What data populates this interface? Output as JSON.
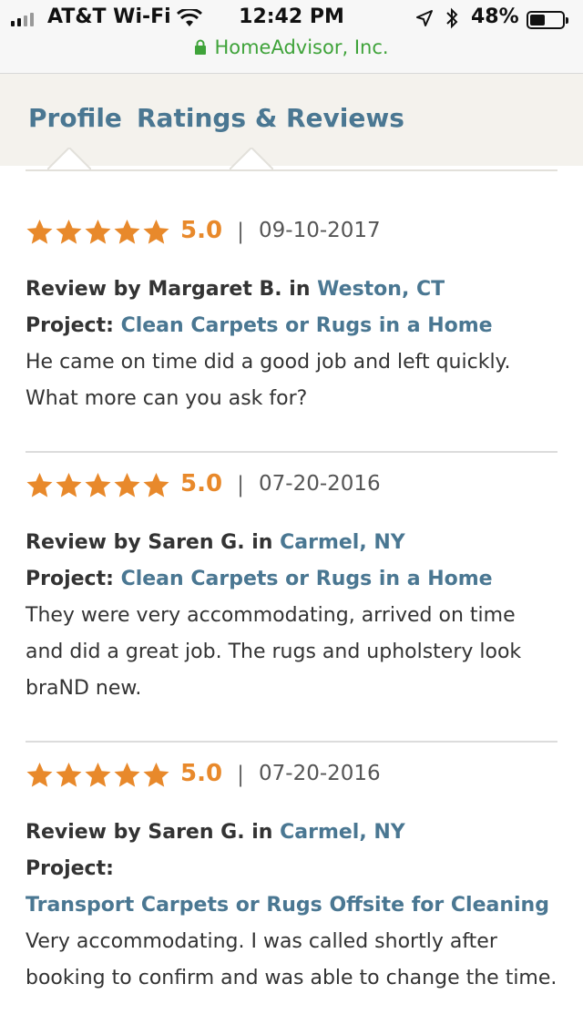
{
  "status_bar": {
    "carrier": "AT&T Wi-Fi",
    "time": "12:42 PM",
    "battery": "48%",
    "battery_level": 0.48,
    "url": "HomeAdvisor, Inc."
  },
  "tabs": [
    {
      "label": "Profile"
    },
    {
      "label": "Ratings & Reviews"
    }
  ],
  "reviews": [
    {
      "stars": 5,
      "score": "5.0",
      "separator": "|",
      "date": "09-10-2017",
      "by_prefix": "Review by Margaret B. in ",
      "location": "Weston, CT",
      "project_label": "Project: ",
      "project": "Clean Carpets or Rugs in a Home",
      "text": "He came on time did a good job and left quickly. What more can you ask for?"
    },
    {
      "stars": 5,
      "score": "5.0",
      "separator": "|",
      "date": "07-20-2016",
      "by_prefix": "Review by Saren G. in ",
      "location": "Carmel, NY",
      "project_label": "Project: ",
      "project": "Clean Carpets or Rugs in a Home",
      "text": "They were very accommodating, arrived on time and did a great job. The rugs and upholstery look braND new."
    },
    {
      "stars": 5,
      "score": "5.0",
      "separator": "|",
      "date": "07-20-2016",
      "by_prefix": "Review by Saren G. in ",
      "location": "Carmel, NY",
      "project_label": "Project:",
      "project": "Transport Carpets or Rugs Offsite for Cleaning",
      "text": "Very accommodating. I was called shortly after booking to confirm and was able to change the time."
    }
  ],
  "colors": {
    "accent_link": "#4a7792",
    "star": "#e8892b",
    "secure": "#3fa33a"
  }
}
